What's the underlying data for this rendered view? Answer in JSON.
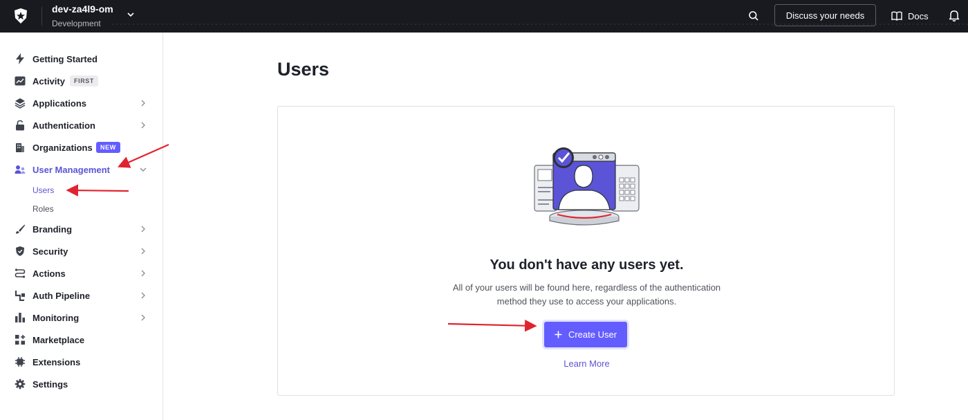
{
  "header": {
    "tenant_name": "dev-za4l9-om",
    "tenant_env": "Development",
    "discuss_label": "Discuss your needs",
    "docs_label": "Docs",
    "bg_color": "#181a20"
  },
  "sidebar": {
    "items": [
      {
        "label": "Getting Started",
        "icon": "lightning-icon"
      },
      {
        "label": "Activity",
        "icon": "trend-chart-icon",
        "badge": "FIRST"
      },
      {
        "label": "Applications",
        "icon": "layers-icon",
        "chevron": true
      },
      {
        "label": "Authentication",
        "icon": "lock-icon",
        "chevron": true
      },
      {
        "label": "Organizations",
        "icon": "building-icon",
        "badge": "NEW"
      },
      {
        "label": "User Management",
        "icon": "users-icon",
        "chevron": true,
        "active": true
      },
      {
        "label": "Branding",
        "icon": "brush-icon",
        "chevron": true
      },
      {
        "label": "Security",
        "icon": "shield-icon",
        "chevron": true
      },
      {
        "label": "Actions",
        "icon": "flow-icon",
        "chevron": true
      },
      {
        "label": "Auth Pipeline",
        "icon": "pipeline-icon",
        "chevron": true
      },
      {
        "label": "Monitoring",
        "icon": "bar-chart-icon",
        "chevron": true
      },
      {
        "label": "Marketplace",
        "icon": "grid-plus-icon"
      },
      {
        "label": "Extensions",
        "icon": "chip-icon"
      },
      {
        "label": "Settings",
        "icon": "gear-icon"
      }
    ],
    "sub_items": [
      {
        "label": "Users",
        "active": true
      },
      {
        "label": "Roles"
      }
    ]
  },
  "main": {
    "title": "Users",
    "empty_title": "You don't have any users yet.",
    "empty_desc": "All of your users will be found here, regardless of the authentication method they use to access your applications.",
    "create_label": "Create User",
    "learn_more_label": "Learn More"
  },
  "colors": {
    "accent": "#635dff",
    "active_text": "#5b54d6",
    "annotation_arrow": "#e0242f"
  }
}
